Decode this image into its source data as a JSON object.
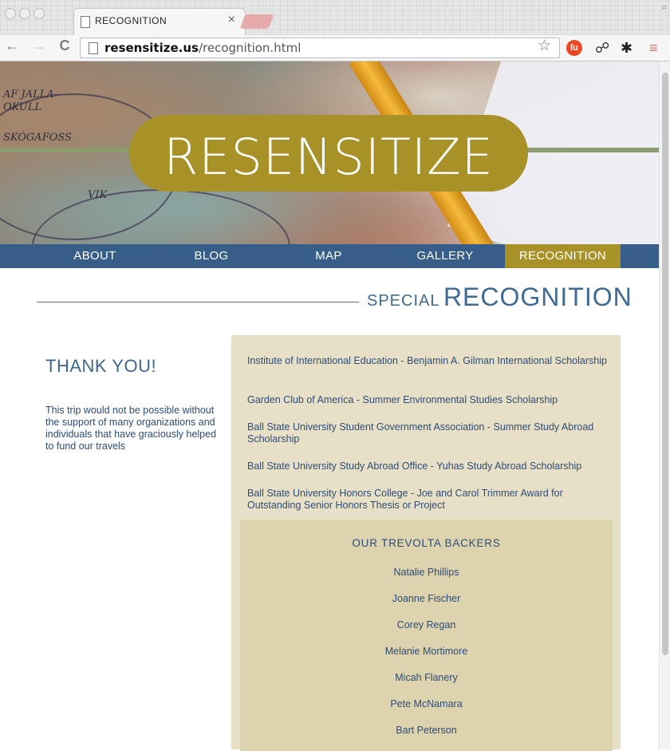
{
  "browser": {
    "tab_title": "RECOGNITION",
    "tab_close": "×",
    "url_domain": "resensitize.us",
    "url_path": "/recognition.html",
    "back": "←",
    "forward": "→",
    "reload": "C",
    "star": "☆",
    "ext_stumble": "ſu",
    "ext_link": "☍",
    "ext_gear": "✱",
    "menu": "≡",
    "win_corner": "⌗"
  },
  "site": {
    "logo": "RESENSITIZE",
    "nav": [
      "ABOUT",
      "BLOG",
      "MAP",
      "GALLERY",
      "RECOGNITION"
    ],
    "active_nav": "RECOGNITION",
    "heading_small": "SPECIAL",
    "heading_big": "RECOGNITION",
    "thank_you_title": "THANK  YOU!",
    "thank_you_body": "This trip would not be possible without the support of many organizations and individuals that have graciously helped to fund our travels",
    "awards": [
      "Institute of International Education - Benjamin A. Gilman International Scholarship",
      "Garden Club of America - Summer Environmental Studies Scholarship",
      "Ball State University Student Government Association - Summer Study Abroad Scholarship",
      "Ball State University Study Abroad Office - Yuhas Study Abroad Scholarship",
      "Ball State University Honors College - Joe and Carol Trimmer Award for Outstanding Senior Honors Thesis or Project"
    ],
    "backers_title": "OUR  TREVOLTA  BACKERS",
    "backers": [
      "Natalie Phillips",
      "Joanne Fischer",
      "Corey Regan",
      "Melanie Mortimore",
      "Micah Flanery",
      "Pete McNamara",
      "Bart Peterson"
    ],
    "map_scribbles": [
      "AF JALLA-",
      "OKULL",
      "SKÓGAFOSS",
      "VIK"
    ]
  },
  "colors": {
    "nav_blue": "#375e88",
    "gold": "#a89227",
    "panel": "#e7e0c6",
    "panel_dark": "#ddd3ae",
    "text_blue": "#2d4c78"
  }
}
